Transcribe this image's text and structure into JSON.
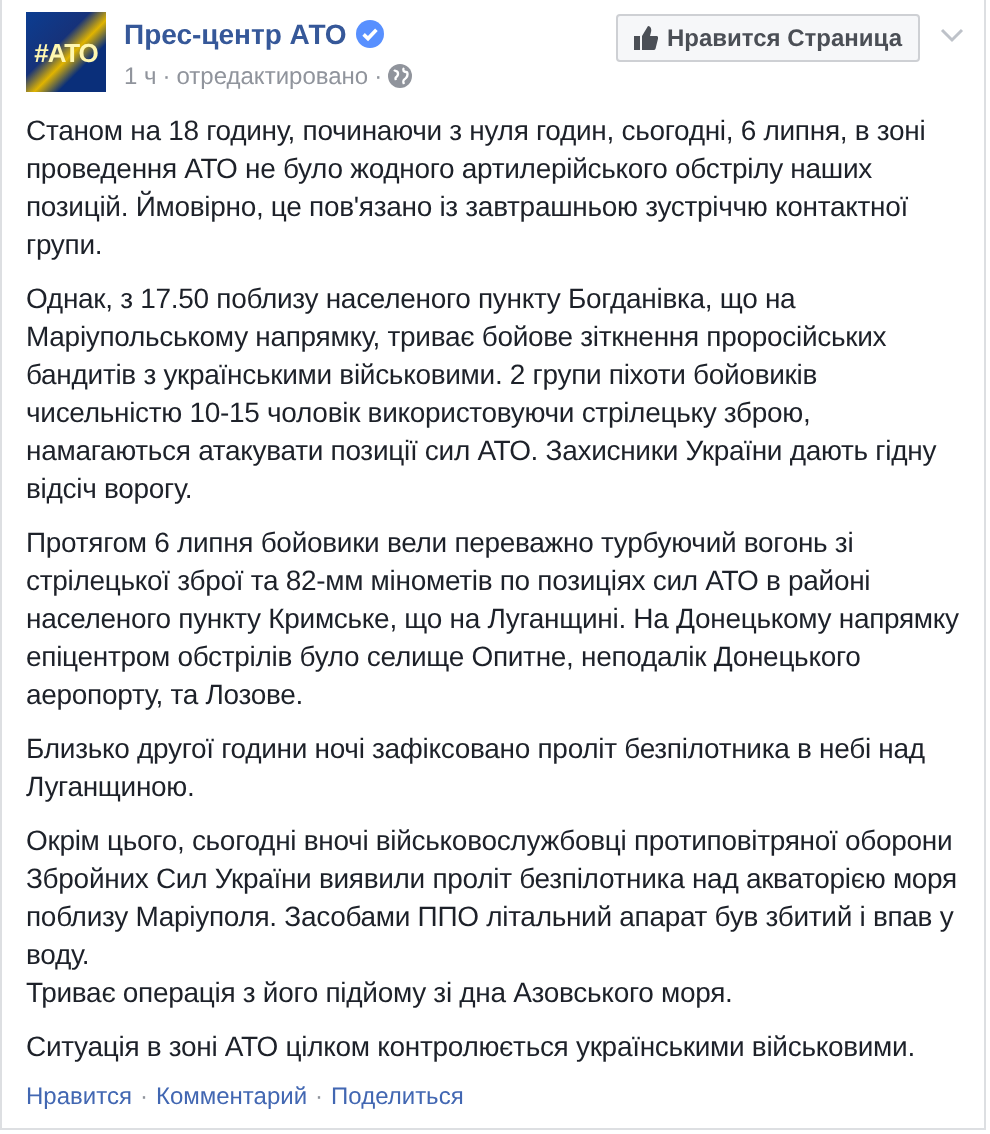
{
  "page": {
    "avatar_text": "#АТО",
    "name": "Прес-центр АТО",
    "verified": true,
    "time": "1 ч",
    "edited": "отредактировано",
    "separator": "·"
  },
  "like_button": {
    "label": "Нравится Страница"
  },
  "paragraphs": [
    "Станом на 18 годину, починаючи з нуля годин, сьогодні, 6 липня, в зоні проведення АТО не було жодного артилерійського обстрілу наших позицій. Ймовірно, це пов'язано із завтрашньою зустріччю контактної групи.",
    "Однак, з 17.50 поблизу населеного пункту Богданівка, що на Маріупольському напрямку, триває бойове зіткнення проросійських бандитів з українськими військовими. 2 групи піхоти бойовиків чисельністю 10-15 чоловік використовуючи стрілецьку зброю, намагаються атакувати позиції сил АТО. Захисники України дають гідну відсіч ворогу.",
    "Протягом 6 липня бойовики вели переважно турбуючий вогонь зі стрілецької зброї та 82-мм мінометів по позиціях сил АТО в районі населеного пункту Кримське, що на Луганщині. На Донецькому напрямку епіцентром обстрілів було селище Опитне, неподалік Донецького аеропорту, та Лозове.",
    "Близько другої години ночі зафіксовано проліт безпілотника в небі над Луганщиною.",
    "Окрім цього, сьогодні вночі військовослужбовці протиповітряної оборони Збройних Сил України виявили проліт безпілотника над акваторією моря поблизу Маріуполя. Засобами ППО літальний апарат був збитий і впав у воду.\nТриває операція з його підйому зі дна Азовського моря.",
    "Ситуація в зоні АТО цілком контролюється українськими військовими."
  ],
  "actions": [
    {
      "label": "Нравится"
    },
    {
      "label": "Комментарий"
    },
    {
      "label": "Поделиться"
    }
  ]
}
